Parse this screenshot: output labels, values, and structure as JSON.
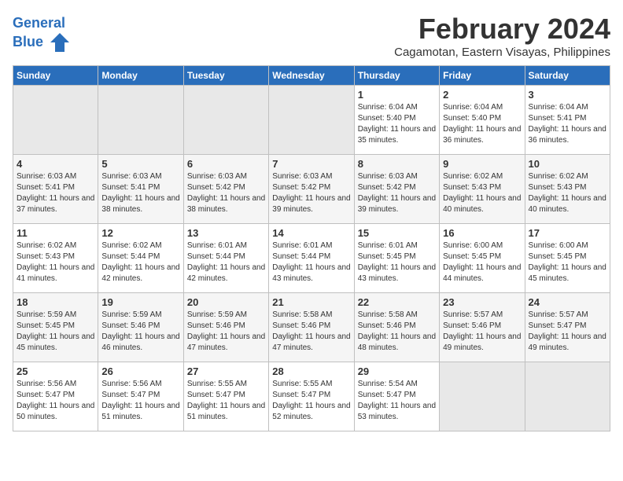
{
  "logo": {
    "line1": "General",
    "line2": "Blue"
  },
  "title": "February 2024",
  "location": "Cagamotan, Eastern Visayas, Philippines",
  "headers": [
    "Sunday",
    "Monday",
    "Tuesday",
    "Wednesday",
    "Thursday",
    "Friday",
    "Saturday"
  ],
  "weeks": [
    [
      {
        "day": "",
        "empty": true
      },
      {
        "day": "",
        "empty": true
      },
      {
        "day": "",
        "empty": true
      },
      {
        "day": "",
        "empty": true
      },
      {
        "day": "1",
        "sunrise": "6:04 AM",
        "sunset": "5:40 PM",
        "daylight": "11 hours and 35 minutes."
      },
      {
        "day": "2",
        "sunrise": "6:04 AM",
        "sunset": "5:40 PM",
        "daylight": "11 hours and 36 minutes."
      },
      {
        "day": "3",
        "sunrise": "6:04 AM",
        "sunset": "5:41 PM",
        "daylight": "11 hours and 36 minutes."
      }
    ],
    [
      {
        "day": "4",
        "sunrise": "6:03 AM",
        "sunset": "5:41 PM",
        "daylight": "11 hours and 37 minutes."
      },
      {
        "day": "5",
        "sunrise": "6:03 AM",
        "sunset": "5:41 PM",
        "daylight": "11 hours and 38 minutes."
      },
      {
        "day": "6",
        "sunrise": "6:03 AM",
        "sunset": "5:42 PM",
        "daylight": "11 hours and 38 minutes."
      },
      {
        "day": "7",
        "sunrise": "6:03 AM",
        "sunset": "5:42 PM",
        "daylight": "11 hours and 39 minutes."
      },
      {
        "day": "8",
        "sunrise": "6:03 AM",
        "sunset": "5:42 PM",
        "daylight": "11 hours and 39 minutes."
      },
      {
        "day": "9",
        "sunrise": "6:02 AM",
        "sunset": "5:43 PM",
        "daylight": "11 hours and 40 minutes."
      },
      {
        "day": "10",
        "sunrise": "6:02 AM",
        "sunset": "5:43 PM",
        "daylight": "11 hours and 40 minutes."
      }
    ],
    [
      {
        "day": "11",
        "sunrise": "6:02 AM",
        "sunset": "5:43 PM",
        "daylight": "11 hours and 41 minutes."
      },
      {
        "day": "12",
        "sunrise": "6:02 AM",
        "sunset": "5:44 PM",
        "daylight": "11 hours and 42 minutes."
      },
      {
        "day": "13",
        "sunrise": "6:01 AM",
        "sunset": "5:44 PM",
        "daylight": "11 hours and 42 minutes."
      },
      {
        "day": "14",
        "sunrise": "6:01 AM",
        "sunset": "5:44 PM",
        "daylight": "11 hours and 43 minutes."
      },
      {
        "day": "15",
        "sunrise": "6:01 AM",
        "sunset": "5:45 PM",
        "daylight": "11 hours and 43 minutes."
      },
      {
        "day": "16",
        "sunrise": "6:00 AM",
        "sunset": "5:45 PM",
        "daylight": "11 hours and 44 minutes."
      },
      {
        "day": "17",
        "sunrise": "6:00 AM",
        "sunset": "5:45 PM",
        "daylight": "11 hours and 45 minutes."
      }
    ],
    [
      {
        "day": "18",
        "sunrise": "5:59 AM",
        "sunset": "5:45 PM",
        "daylight": "11 hours and 45 minutes."
      },
      {
        "day": "19",
        "sunrise": "5:59 AM",
        "sunset": "5:46 PM",
        "daylight": "11 hours and 46 minutes."
      },
      {
        "day": "20",
        "sunrise": "5:59 AM",
        "sunset": "5:46 PM",
        "daylight": "11 hours and 47 minutes."
      },
      {
        "day": "21",
        "sunrise": "5:58 AM",
        "sunset": "5:46 PM",
        "daylight": "11 hours and 47 minutes."
      },
      {
        "day": "22",
        "sunrise": "5:58 AM",
        "sunset": "5:46 PM",
        "daylight": "11 hours and 48 minutes."
      },
      {
        "day": "23",
        "sunrise": "5:57 AM",
        "sunset": "5:46 PM",
        "daylight": "11 hours and 49 minutes."
      },
      {
        "day": "24",
        "sunrise": "5:57 AM",
        "sunset": "5:47 PM",
        "daylight": "11 hours and 49 minutes."
      }
    ],
    [
      {
        "day": "25",
        "sunrise": "5:56 AM",
        "sunset": "5:47 PM",
        "daylight": "11 hours and 50 minutes."
      },
      {
        "day": "26",
        "sunrise": "5:56 AM",
        "sunset": "5:47 PM",
        "daylight": "11 hours and 51 minutes."
      },
      {
        "day": "27",
        "sunrise": "5:55 AM",
        "sunset": "5:47 PM",
        "daylight": "11 hours and 51 minutes."
      },
      {
        "day": "28",
        "sunrise": "5:55 AM",
        "sunset": "5:47 PM",
        "daylight": "11 hours and 52 minutes."
      },
      {
        "day": "29",
        "sunrise": "5:54 AM",
        "sunset": "5:47 PM",
        "daylight": "11 hours and 53 minutes."
      },
      {
        "day": "",
        "empty": true
      },
      {
        "day": "",
        "empty": true
      }
    ]
  ],
  "labels": {
    "sunrise": "Sunrise:",
    "sunset": "Sunset:",
    "daylight": "Daylight hours"
  }
}
